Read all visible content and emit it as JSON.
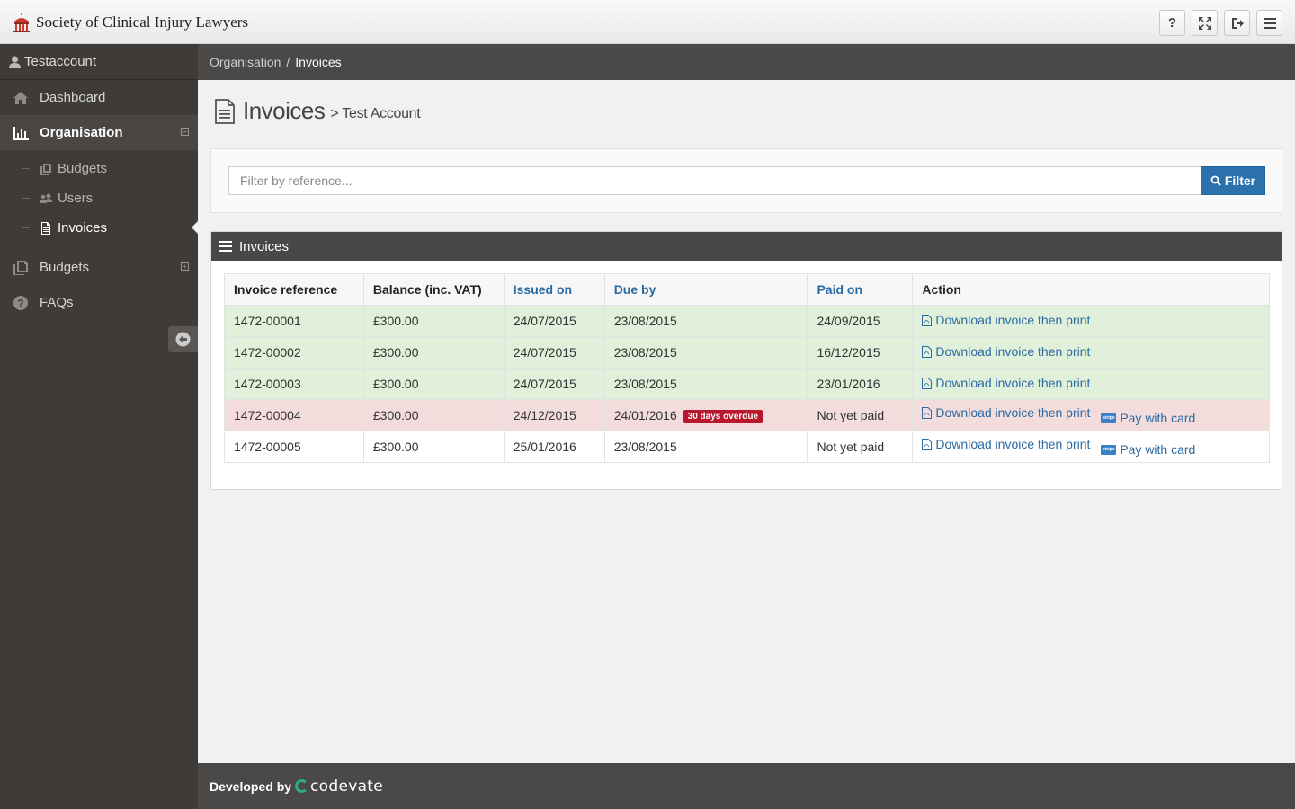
{
  "app": {
    "title": "Society of Clinical Injury Lawyers"
  },
  "topbar": {
    "help_label": "?",
    "buttons": [
      "help-icon",
      "fullscreen-icon",
      "logout-icon",
      "menu-icon"
    ]
  },
  "sidebar": {
    "user": "Testaccount",
    "items": [
      {
        "label": "Dashboard",
        "icon": "home-icon"
      },
      {
        "label": "Organisation",
        "icon": "chart-icon",
        "toggle": "−"
      },
      {
        "label": "Budgets",
        "icon": "budgets-icon",
        "toggle": "+"
      },
      {
        "label": "FAQs",
        "icon": "question-icon"
      }
    ],
    "subitems": [
      {
        "label": "Budgets",
        "icon": "budgets-icon"
      },
      {
        "label": "Users",
        "icon": "users-icon"
      },
      {
        "label": "Invoices",
        "icon": "file-icon"
      }
    ]
  },
  "breadcrumb": {
    "parent": "Organisation",
    "separator": "/",
    "current": "Invoices"
  },
  "page": {
    "title": "Invoices",
    "subtitle": "> Test Account"
  },
  "filter": {
    "placeholder": "Filter by reference...",
    "button_label": "Filter"
  },
  "invoices_panel": {
    "title": "Invoices",
    "columns": [
      "Invoice reference",
      "Balance (inc. VAT)",
      "Issued on",
      "Due by",
      "Paid on",
      "Action"
    ],
    "rows": [
      {
        "ref": "1472-00001",
        "balance": "£300.00",
        "issued": "24/07/2015",
        "due": "23/08/2015",
        "badge": "",
        "paid": "24/09/2015",
        "download": "Download invoice then print",
        "pay": ""
      },
      {
        "ref": "1472-00002",
        "balance": "£300.00",
        "issued": "24/07/2015",
        "due": "23/08/2015",
        "badge": "",
        "paid": "16/12/2015",
        "download": "Download invoice then print",
        "pay": ""
      },
      {
        "ref": "1472-00003",
        "balance": "£300.00",
        "issued": "24/07/2015",
        "due": "23/08/2015",
        "badge": "",
        "paid": "23/01/2016",
        "download": "Download invoice then print",
        "pay": ""
      },
      {
        "ref": "1472-00004",
        "balance": "£300.00",
        "issued": "24/12/2015",
        "due": "24/01/2016",
        "badge": "30 days overdue",
        "paid": "Not yet paid",
        "download": "Download invoice then print",
        "pay": "Pay with card"
      },
      {
        "ref": "1472-00005",
        "balance": "£300.00",
        "issued": "25/01/2016",
        "due": "23/08/2015",
        "badge": "",
        "paid": "Not yet paid",
        "download": "Download invoice then print",
        "pay": "Pay with card"
      }
    ]
  },
  "footer": {
    "prefix": "Developed by",
    "brand": "codevate"
  },
  "colors": {
    "accent": "#2b72ad",
    "paid_row": "#e1f0da",
    "overdue_row": "#f2dcdc",
    "overdue_badge": "#b8172d",
    "sidebar": "#3f3b38"
  }
}
